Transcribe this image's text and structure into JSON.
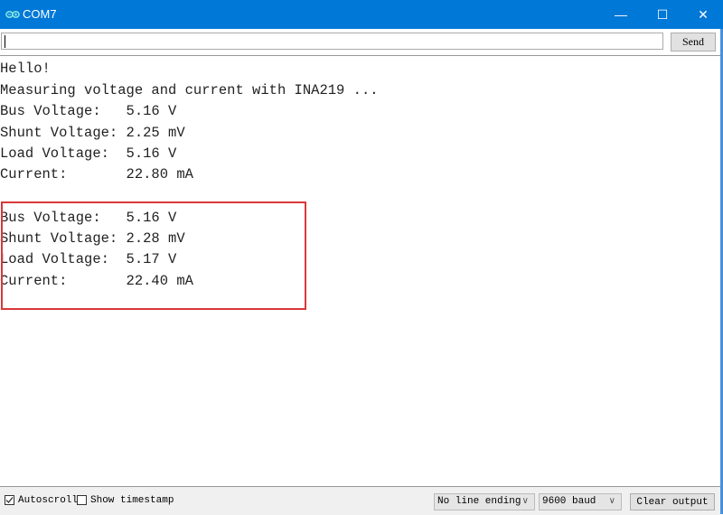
{
  "window": {
    "title": "COM7",
    "logo_icon": "arduino-infinity-icon",
    "controls": {
      "minimize": "—",
      "maximize": "☐",
      "close": "✕"
    },
    "accent_color": "#0078d7"
  },
  "input": {
    "value": "",
    "send_label": "Send"
  },
  "output": {
    "lines": [
      "Hello!",
      "Measuring voltage and current with INA219 ...",
      "Bus Voltage:   5.16 V",
      "Shunt Voltage: 2.25 mV",
      "Load Voltage:  5.16 V",
      "Current:       22.80 mA",
      "",
      "Bus Voltage:   5.16 V",
      "Shunt Voltage: 2.28 mV",
      "Load Voltage:  5.17 V",
      "Current:       22.40 mA"
    ],
    "highlight_color": "#d9383a"
  },
  "bottom": {
    "autoscroll": {
      "label": "Autoscroll",
      "checked": true
    },
    "timestamp": {
      "label": "Show timestamp",
      "checked": false
    },
    "line_ending": {
      "selected": "No line ending"
    },
    "baud": {
      "selected": "9600 baud"
    },
    "clear_label": "Clear output"
  }
}
